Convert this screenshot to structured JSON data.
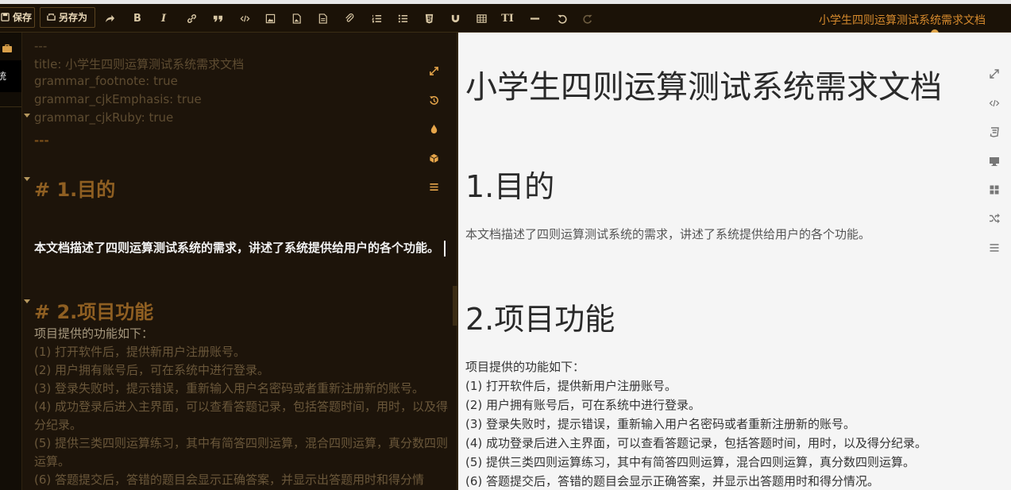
{
  "toolbar": {
    "save_label": "保存",
    "saveas_label": "另存为",
    "bold_glyph": "B",
    "italic_glyph": "I",
    "title_glyph": "TI",
    "document_title": "小学生四则运算测试系统需求文档"
  },
  "sidebar": {
    "active_tab_label": "统"
  },
  "editor": {
    "frontmatter": [
      "---",
      "title: 小学生四则运算测试系统需求文档",
      "grammar_footnote: true",
      "grammar_cjkEmphasis: true",
      "grammar_cjkRuby: true",
      "---"
    ],
    "heading1": "# 1.目的",
    "paragraph1": " 本文档描述了四则运算测试系统的需求，讲述了系统提供给用户的各个功能。",
    "heading2": "# 2.项目功能",
    "list_intro": "项目提供的功能如下：",
    "list_items": [
      "(1) 打开软件后，提供新用户注册账号。",
      "(2) 用户拥有账号后，可在系统中进行登录。",
      "(3) 登录失败时，提示错误，重新输入用户名密码或者重新注册新的账号。",
      "(4) 成功登录后进入主界面，可以查看答题记录，包括答题时间，用时，以及得分纪录。",
      "(5) 提供三类四则运算练习，其中有简答四则运算，混合四则运算，真分数四则运算。",
      "(6) 答题提交后，答错的题目会显示正确答案，并显示出答题用时和得分情"
    ]
  },
  "preview": {
    "title": "小学生四则运算测试系统需求文档",
    "heading1": "1.目的",
    "paragraph1": "本文档描述了四则运算测试系统的需求，讲述了系统提供给用户的各个功能。",
    "heading2": "2.项目功能",
    "list_intro": "项目提供的功能如下：",
    "list_items": [
      "(1) 打开软件后，提供新用户注册账号。",
      "(2) 用户拥有账号后，可在系统中进行登录。",
      "(3) 登录失败时，提示错误，重新输入用户名密码或者重新注册新的账号。",
      "(4) 成功登录后进入主界面，可以查看答题记录，包括答题时间，用时，以及得分纪录。",
      "(5) 提供三类四则运算练习，其中有简答四则运算，混合四则运算，真分数四则运算。",
      "(6) 答题提交后，答错的题目会显示正确答案，并显示出答题用时和得分情况。"
    ]
  },
  "colors": {
    "toolbar_bg": "#1b1207",
    "editor_bg": "#1d140a",
    "accent_orange": "#d5892c",
    "preview_bg": "#f5f5f5"
  },
  "icons": {
    "toolbar": [
      "save-icon",
      "saveas-icon",
      "share-icon",
      "bold-icon",
      "italic-icon",
      "link-icon",
      "quote-icon",
      "code-icon",
      "image-icon",
      "file-image-icon",
      "file-icon",
      "attachment-icon",
      "ordered-list-icon",
      "unordered-list-icon",
      "html5-icon",
      "magnet-icon",
      "table-icon",
      "title-icon",
      "horizontal-rule-icon",
      "undo-icon",
      "redo-icon"
    ],
    "editor_float": [
      "expand-icon",
      "history-icon",
      "drop-icon",
      "cube-icon",
      "menu-icon"
    ],
    "preview_side": [
      "expand-icon",
      "code-icon",
      "css3-icon",
      "desktop-icon",
      "grid-icon",
      "shuffle-icon",
      "menu-icon"
    ]
  }
}
